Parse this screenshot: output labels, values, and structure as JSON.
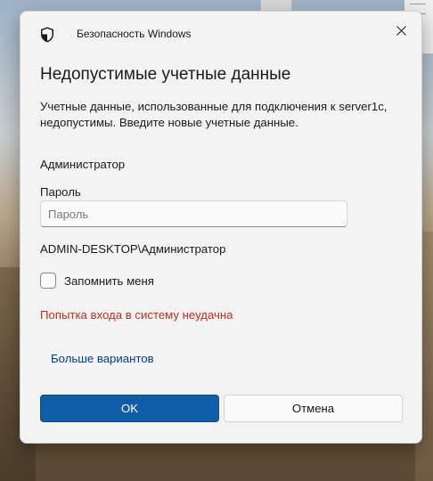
{
  "window": {
    "title": "Безопасность Windows",
    "shield_icon": "shield-icon",
    "close_icon": "close-icon"
  },
  "dialog": {
    "heading": "Недопустимые учетные данные",
    "description": "Учетные данные, использованные для подключения к server1c, недопустимы. Введите новые учетные данные.",
    "username": "Администратор",
    "password_label": "Пароль",
    "password_placeholder": "Пароль",
    "password_value": "",
    "domain_user": "ADMIN-DESKTOP\\Администратор",
    "remember_label": "Запомнить меня",
    "remember_checked": false,
    "error_text": "Попытка входа в систему неудачна",
    "more_options": "Больше вариантов",
    "ok_label": "OK",
    "cancel_label": "Отмена"
  },
  "colors": {
    "accent": "#0f5ca8",
    "error": "#c42b1c",
    "link": "#003e92"
  }
}
